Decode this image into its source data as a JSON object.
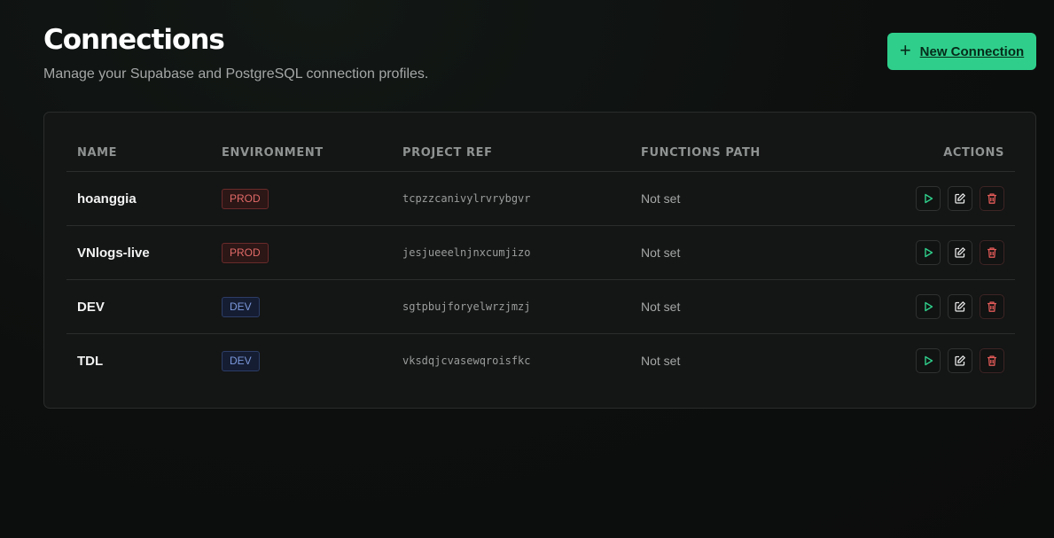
{
  "header": {
    "title": "Connections",
    "subtitle": "Manage your Supabase and PostgreSQL connection profiles.",
    "new_button_label": "New Connection",
    "new_button_icon": "plus-icon"
  },
  "colors": {
    "accent": "#2fcf8b",
    "prod_badge": "#e06a67",
    "dev_badge": "#7b98da",
    "run_icon": "#2fcf8b",
    "delete_icon": "#e05a57"
  },
  "table": {
    "columns": [
      "NAME",
      "ENVIRONMENT",
      "PROJECT REF",
      "FUNCTIONS PATH",
      "ACTIONS"
    ],
    "rows": [
      {
        "name": "hoanggia",
        "environment": "PROD",
        "project_ref": "tcpzzcanivylrvrybgvr",
        "functions_path": "Not set"
      },
      {
        "name": "VNlogs-live",
        "environment": "PROD",
        "project_ref": "jesjueeelnjnxcumjizo",
        "functions_path": "Not set"
      },
      {
        "name": "DEV",
        "environment": "DEV",
        "project_ref": "sgtpbujforyelwrzjmzj",
        "functions_path": "Not set"
      },
      {
        "name": "TDL",
        "environment": "DEV",
        "project_ref": "vksdqjcvasewqroisfkc",
        "functions_path": "Not set"
      }
    ],
    "row_actions": [
      "play-icon",
      "edit-icon",
      "trash-icon"
    ]
  }
}
